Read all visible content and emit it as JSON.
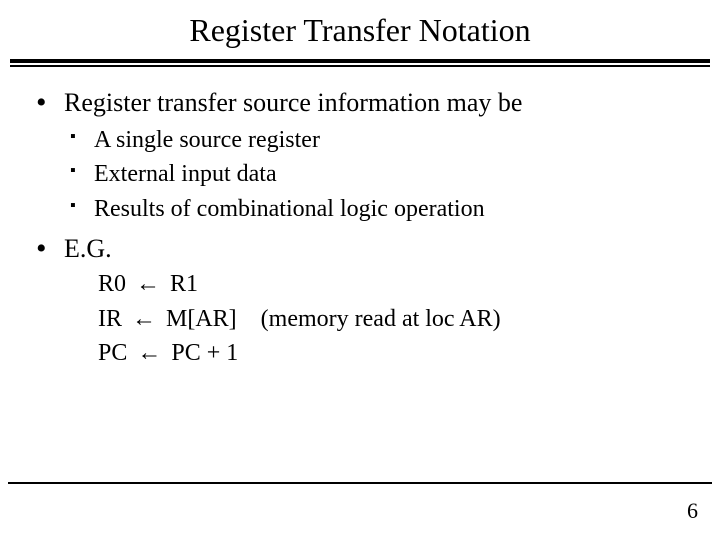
{
  "title": "Register Transfer Notation",
  "bullets": {
    "b1": "Register transfer source information may be",
    "b1_subs": {
      "s1": "A single source register",
      "s2": "External input data",
      "s3": "Results of combinational logic operation"
    },
    "b2": "E.G."
  },
  "arrow": "←",
  "eg": {
    "l1_left": "R0",
    "l1_right": "R1",
    "l2_left": "IR",
    "l2_right": "M[AR]",
    "l2_note": "(memory read at loc AR)",
    "l3_left": "PC",
    "l3_right": "PC + 1"
  },
  "page_number": "6"
}
